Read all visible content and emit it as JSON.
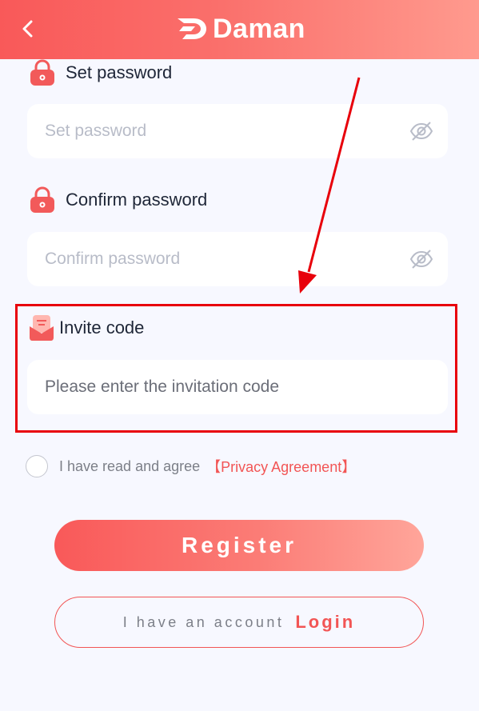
{
  "header": {
    "brand": "Daman"
  },
  "set_password": {
    "label": "Set password",
    "placeholder": "Set password"
  },
  "confirm_password": {
    "label": "Confirm password",
    "placeholder": "Confirm password"
  },
  "invite": {
    "label": "Invite code",
    "placeholder": "Please enter the invitation code"
  },
  "agreement": {
    "text": "I have read and agree",
    "link": "【Privacy Agreement】"
  },
  "buttons": {
    "register": "Register",
    "have_account": "I have an account",
    "login": "Login"
  },
  "colors": {
    "accent": "#f95959",
    "annotation": "#e8000b"
  },
  "icons": [
    "back-chevron-icon",
    "daman-logo-icon",
    "lock-icon",
    "eye-off-icon",
    "invite-icon"
  ]
}
